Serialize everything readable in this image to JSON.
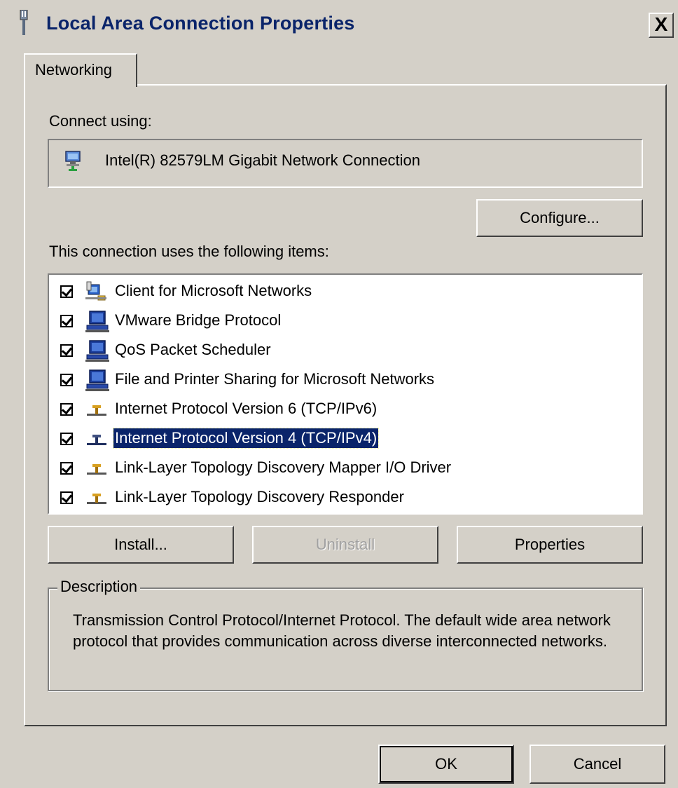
{
  "window": {
    "title": "Local Area Connection Properties",
    "close_label": "X"
  },
  "tabs": [
    {
      "label": "Networking",
      "selected": true
    }
  ],
  "connect_using": {
    "label": "Connect using:",
    "adapter_name": "Intel(R) 82579LM Gigabit Network Connection",
    "adapter_icon": "network-adapter-icon"
  },
  "configure_button": {
    "label": "Configure..."
  },
  "items_section": {
    "label": "This connection uses the following items:",
    "items": [
      {
        "label": "Client for Microsoft Networks",
        "checked": true,
        "icon": "client-network-icon",
        "selected": false
      },
      {
        "label": "VMware Bridge Protocol",
        "checked": true,
        "icon": "computer-network-icon",
        "selected": false
      },
      {
        "label": "QoS Packet Scheduler",
        "checked": true,
        "icon": "computer-network-icon",
        "selected": false
      },
      {
        "label": "File and Printer Sharing for Microsoft Networks",
        "checked": true,
        "icon": "computer-network-icon",
        "selected": false
      },
      {
        "label": "Internet Protocol Version 6 (TCP/IPv6)",
        "checked": true,
        "icon": "protocol-icon",
        "selected": false
      },
      {
        "label": "Internet Protocol Version 4 (TCP/IPv4)",
        "checked": true,
        "icon": "protocol-icon",
        "selected": true
      },
      {
        "label": "Link-Layer Topology Discovery Mapper I/O Driver",
        "checked": true,
        "icon": "protocol-icon",
        "selected": false
      },
      {
        "label": "Link-Layer Topology Discovery Responder",
        "checked": true,
        "icon": "protocol-icon",
        "selected": false
      }
    ]
  },
  "buttons": {
    "install": "Install...",
    "uninstall": "Uninstall",
    "properties": "Properties",
    "ok": "OK",
    "cancel": "Cancel"
  },
  "description": {
    "label": "Description",
    "text": "Transmission Control Protocol/Internet Protocol. The default wide area network protocol that provides communication across diverse interconnected networks."
  },
  "colors": {
    "dialog_bg": "#d4d0c8",
    "title_text": "#0a246a",
    "selection_bg": "#0a246a"
  }
}
